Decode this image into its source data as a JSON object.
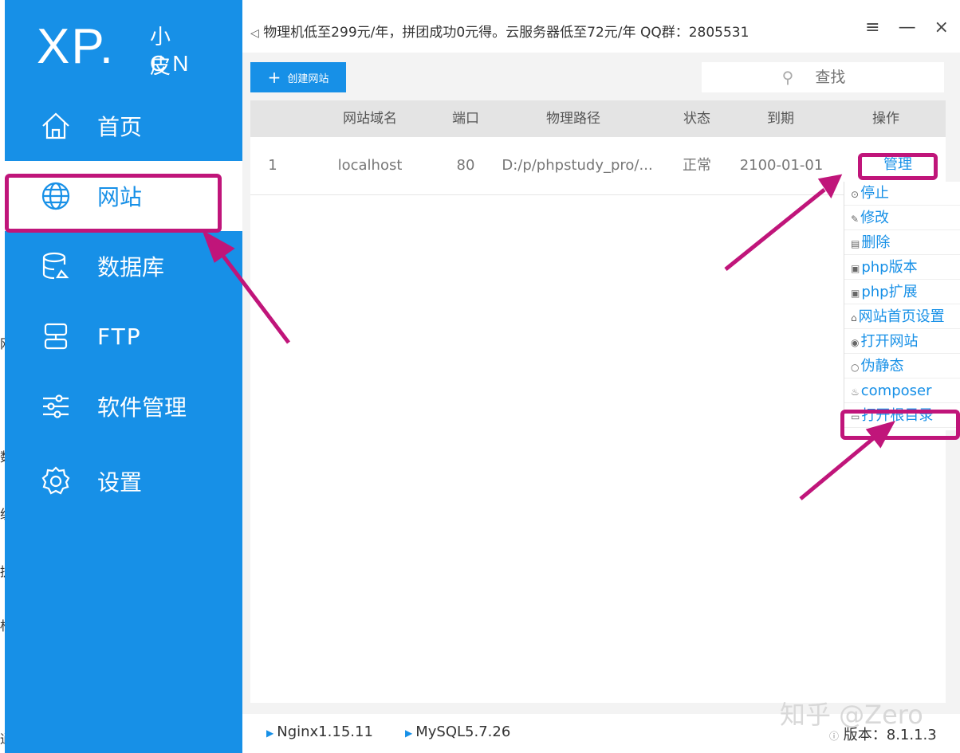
{
  "background_edge": [
    "网",
    "数",
    "统",
    "提",
    "标",
    "通"
  ],
  "logo": {
    "xp": "XP.",
    "cn_top": "小皮",
    "cn_bottom": "CN"
  },
  "sidebar": {
    "items": [
      {
        "label": "首页",
        "icon": "home-icon"
      },
      {
        "label": "网站",
        "icon": "globe-icon",
        "active": true
      },
      {
        "label": "数据库",
        "icon": "database-icon"
      },
      {
        "label": "FTP",
        "icon": "ftp-icon"
      },
      {
        "label": "软件管理",
        "icon": "sliders-icon"
      },
      {
        "label": "设置",
        "icon": "gear-icon"
      }
    ]
  },
  "topbar": {
    "notice": "物理机低至299元/年，拼团成功0元得。云服务器低至72元/年 QQ群：2805531",
    "controls": "≡ — ×"
  },
  "toolbar": {
    "create_label": "创建网站",
    "search_placeholder": "查找"
  },
  "table": {
    "headers": [
      "网站域名",
      "端口",
      "物理路径",
      "状态",
      "到期",
      "操作"
    ],
    "rows": [
      {
        "index": "1",
        "domain": "localhost",
        "port": "80",
        "path": "D:/p/phpstudy_pro/...",
        "status": "正常",
        "expire": "2100-01-01",
        "action": "管理"
      }
    ]
  },
  "dropdown": {
    "items": [
      "停止",
      "修改",
      "删除",
      "php版本",
      "php扩展",
      "网站首页设置",
      "打开网站",
      "伪静态",
      "composer",
      "打开根目录"
    ]
  },
  "footer": {
    "nginx": "Nginx1.15.11",
    "mysql": "MySQL5.7.26",
    "version": "版本：8.1.1.3"
  },
  "watermark": "知乎 @Zero",
  "colors": {
    "accent": "#1790e7",
    "highlight": "#c0157a"
  }
}
